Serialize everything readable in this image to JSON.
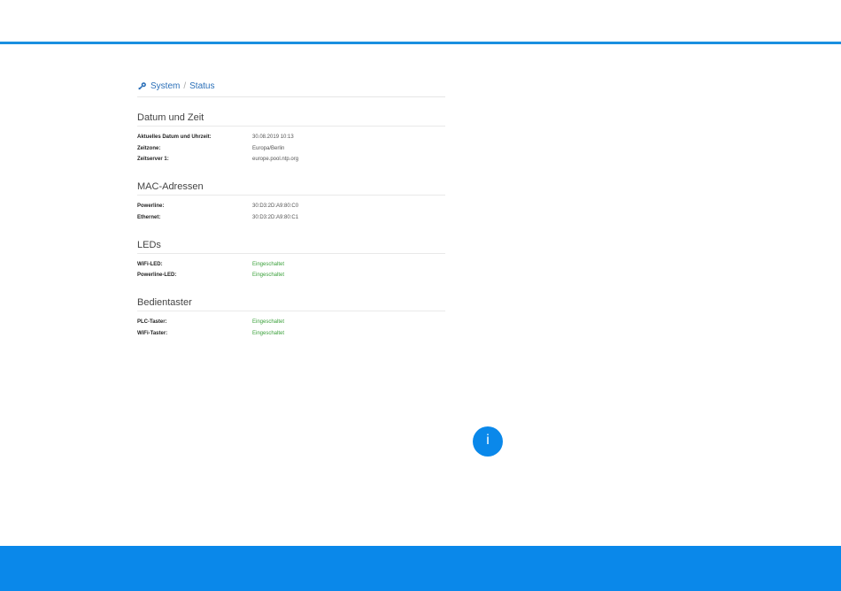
{
  "breadcrumb": {
    "icon": "gear-key-icon",
    "items": [
      "System",
      "Status"
    ],
    "separator": "/"
  },
  "sections": [
    {
      "title": "Datum und Zeit",
      "rows": [
        {
          "label": "Aktuelles Datum und Uhrzeit:",
          "value": "30.08.2019 10:13"
        },
        {
          "label": "Zeitzone:",
          "value": "Europa/Berlin"
        },
        {
          "label": "Zeitserver 1:",
          "value": "europe.pool.ntp.org"
        }
      ]
    },
    {
      "title": "MAC-Adressen",
      "rows": [
        {
          "label": "Powerline:",
          "value": "30:D3:2D:A9:80:C0"
        },
        {
          "label": "Ethernet:",
          "value": "30:D3:2D:A9:80:C1"
        }
      ]
    },
    {
      "title": "LEDs",
      "rows": [
        {
          "label": "WiFi-LED:",
          "value": "Eingeschaltet"
        },
        {
          "label": "Powerline-LED:",
          "value": "Eingeschaltet"
        }
      ]
    },
    {
      "title": "Bedientaster",
      "rows": [
        {
          "label": "PLC-Taster:",
          "value": "Eingeschaltet"
        },
        {
          "label": "WiFi-Taster:",
          "value": "Eingeschaltet"
        }
      ]
    }
  ],
  "info_button": {
    "label": "i",
    "icon": "info-icon"
  },
  "colors": {
    "accent": "#0a88ea",
    "link": "#2a6fb8",
    "status_ok": "#3aa03a"
  }
}
